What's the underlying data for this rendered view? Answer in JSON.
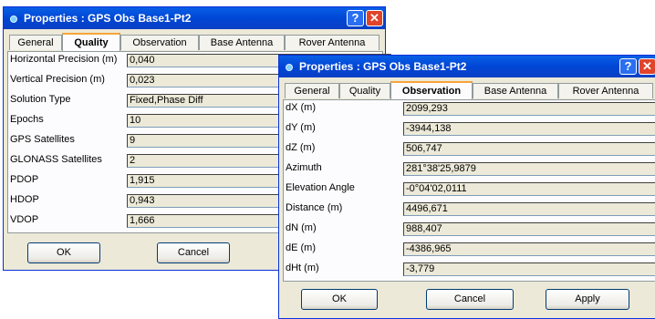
{
  "dialog_quality": {
    "title": "Properties : GPS Obs Base1-Pt2",
    "help": "?",
    "close": "✕",
    "tabs": [
      "General",
      "Quality",
      "Observation",
      "Base Antenna",
      "Rover Antenna"
    ],
    "active_tab": "Quality",
    "fields": [
      {
        "label": "Horizontal Precision (m)",
        "value": "0,040"
      },
      {
        "label": "Vertical Precision (m)",
        "value": "0,023"
      },
      {
        "label": "Solution Type",
        "value": "Fixed,Phase Diff"
      },
      {
        "label": "Epochs",
        "value": "10"
      },
      {
        "label": "GPS Satellites",
        "value": "9"
      },
      {
        "label": "GLONASS Satellites",
        "value": "2"
      },
      {
        "label": "PDOP",
        "value": "1,915"
      },
      {
        "label": "HDOP",
        "value": "0,943"
      },
      {
        "label": "VDOP",
        "value": "1,666"
      }
    ],
    "ok_label": "OK",
    "cancel_label": "Cancel"
  },
  "dialog_observation": {
    "title": "Properties : GPS Obs Base1-Pt2",
    "help": "?",
    "close": "✕",
    "tabs": [
      "General",
      "Quality",
      "Observation",
      "Base Antenna",
      "Rover Antenna"
    ],
    "active_tab": "Observation",
    "fields": [
      {
        "label": "dX (m)",
        "value": "2099,293"
      },
      {
        "label": "dY (m)",
        "value": "-3944,138"
      },
      {
        "label": "dZ (m)",
        "value": "506,747"
      },
      {
        "label": "Azimuth",
        "value": "281°38'25,9879"
      },
      {
        "label": "Elevation Angle",
        "value": "-0°04'02,0111"
      },
      {
        "label": "Distance (m)",
        "value": "4496,671"
      },
      {
        "label": "dN (m)",
        "value": "988,407"
      },
      {
        "label": "dE (m)",
        "value": "-4386,965"
      },
      {
        "label": "dHt (m)",
        "value": "-3,779"
      }
    ],
    "ok_label": "OK",
    "cancel_label": "Cancel",
    "apply_label": "Apply"
  }
}
